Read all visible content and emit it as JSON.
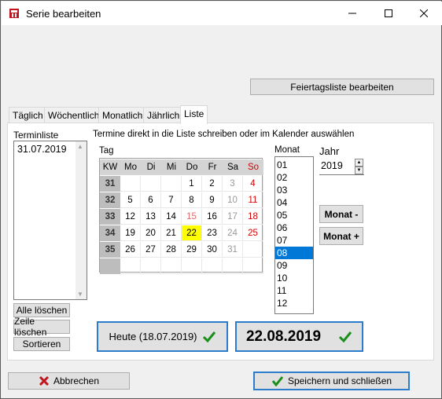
{
  "window": {
    "title": "Serie bearbeiten"
  },
  "buttons": {
    "feiertag": "Feiertagsliste bearbeiten",
    "alle_loeschen": "Alle löschen",
    "zeile_loeschen": "Zeile löschen",
    "sortieren": "Sortieren",
    "monat_minus": "Monat -",
    "monat_plus": "Monat +",
    "heute": "Heute (18.07.2019)",
    "selected_date": "22.08.2019",
    "abbrechen": "Abbrechen",
    "speichern": "Speichern und schließen"
  },
  "tabs": [
    "Täglich",
    "Wöchentlich",
    "Monatlich",
    "Jährlich",
    "Liste"
  ],
  "labels": {
    "terminliste": "Terminliste",
    "hint": "Termine direkt in die Liste schreiben oder im Kalender auswählen",
    "tag": "Tag",
    "monat": "Monat",
    "jahr": "Jahr"
  },
  "terminliste": [
    "31.07.2019"
  ],
  "calendar": {
    "headers": [
      "KW",
      "Mo",
      "Di",
      "Mi",
      "Do",
      "Fr",
      "Sa",
      "So"
    ],
    "weeks": [
      [
        "31",
        "",
        "",
        "",
        "1",
        "2",
        "3",
        "4"
      ],
      [
        "32",
        "5",
        "6",
        "7",
        "8",
        "9",
        "10",
        "11"
      ],
      [
        "33",
        "12",
        "13",
        "14",
        "15",
        "16",
        "17",
        "18"
      ],
      [
        "34",
        "19",
        "20",
        "21",
        "22",
        "23",
        "24",
        "25"
      ],
      [
        "35",
        "26",
        "27",
        "28",
        "29",
        "30",
        "31",
        ""
      ]
    ],
    "selected_day": "22"
  },
  "months": [
    "01",
    "02",
    "03",
    "04",
    "05",
    "06",
    "07",
    "08",
    "09",
    "10",
    "11",
    "12"
  ],
  "selected_month": "08",
  "year": "2019",
  "colors": {
    "accent": "#2b7dcc",
    "selection": "#0078d7",
    "sunday": "#d40000",
    "highlight": "#ffff00",
    "check": "#1a8f1a",
    "cancel": "#c0141e"
  }
}
